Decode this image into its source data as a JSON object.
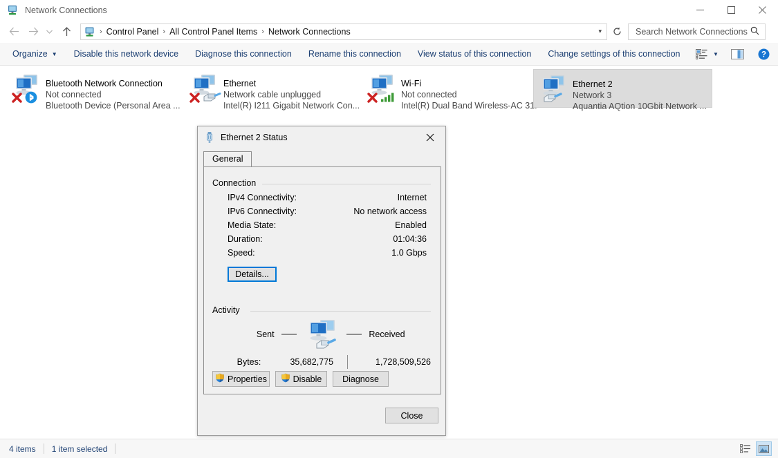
{
  "window": {
    "title": "Network Connections",
    "icon": "network-connections-icon",
    "controls": {
      "minimize": "minimize-button",
      "maximize": "maximize-button",
      "close": "close-button"
    }
  },
  "nav": {
    "back": "back-button",
    "forward": "forward-button",
    "recent": "recent-locations-button",
    "up": "up-one-level-button",
    "refresh": "refresh-button"
  },
  "breadcrumb": {
    "icon": "network-connections-icon",
    "items": [
      "Control Panel",
      "All Control Panel Items",
      "Network Connections"
    ],
    "separator": "›",
    "dropdown": "▾"
  },
  "search": {
    "placeholder": "Search Network Connections",
    "value": "",
    "icon": "search-icon"
  },
  "command_bar": {
    "items": [
      {
        "label": "Organize",
        "has_caret": true
      },
      {
        "label": "Disable this network device",
        "has_caret": false
      },
      {
        "label": "Diagnose this connection",
        "has_caret": false
      },
      {
        "label": "Rename this connection",
        "has_caret": false
      },
      {
        "label": "View status of this connection",
        "has_caret": false
      },
      {
        "label": "Change settings of this connection",
        "has_caret": false
      }
    ],
    "caret_glyph": "▼",
    "view_options_icon": "change-view-icon",
    "preview_pane_icon": "preview-pane-icon",
    "help_icon": "help-icon"
  },
  "connections": [
    {
      "name": "Bluetooth Network Connection",
      "status": "Not connected",
      "adapter": "Bluetooth Device (Personal Area ...",
      "icon": "network-adapter-icon",
      "overlay": "bluetooth-icon",
      "error": true,
      "selected": false
    },
    {
      "name": "Ethernet",
      "status": "Network cable unplugged",
      "adapter": "Intel(R) I211 Gigabit Network Con...",
      "icon": "network-adapter-icon",
      "overlay": "rj45-plug-icon",
      "error": true,
      "selected": false
    },
    {
      "name": "Wi-Fi",
      "status": "Not connected",
      "adapter": "Intel(R) Dual Band Wireless-AC 31...",
      "icon": "network-adapter-icon",
      "overlay": "wifi-signal-icon",
      "error": true,
      "selected": false
    },
    {
      "name": "Ethernet 2",
      "status": "Network 3",
      "adapter": "Aquantia AQtion 10Gbit Network ...",
      "icon": "network-adapter-icon",
      "overlay": "rj45-plug-icon",
      "error": false,
      "selected": true
    }
  ],
  "status_bar": {
    "item_count": "4 items",
    "selection": "1 item selected",
    "details_view_icon": "details-view-icon",
    "large-icons_view_icon": "large-icons-view-icon"
  },
  "dialog": {
    "title": "Ethernet 2 Status",
    "icon": "network-plug-icon",
    "close": "✕",
    "tabs": [
      {
        "label": "General",
        "active": true
      }
    ],
    "connection": {
      "group_label": "Connection",
      "rows": [
        {
          "key": "IPv4 Connectivity:",
          "value": "Internet"
        },
        {
          "key": "IPv6 Connectivity:",
          "value": "No network access"
        },
        {
          "key": "Media State:",
          "value": "Enabled"
        },
        {
          "key": "Duration:",
          "value": "01:04:36"
        },
        {
          "key": "Speed:",
          "value": "1.0 Gbps"
        }
      ],
      "details_button": "Details..."
    },
    "activity": {
      "group_label": "Activity",
      "sent_label": "Sent",
      "received_label": "Received",
      "icon": "network-activity-icon",
      "bytes_label": "Bytes:",
      "bytes_sent": "35,682,775",
      "bytes_received": "1,728,509,526"
    },
    "buttons": {
      "properties": "Properties",
      "disable": "Disable",
      "diagnose": "Diagnose",
      "close": "Close",
      "shield_icon": "uac-shield-icon"
    }
  },
  "colors": {
    "accent": "#0078d7",
    "command_text": "#1c3f72",
    "selection": "#dcdcdc"
  }
}
